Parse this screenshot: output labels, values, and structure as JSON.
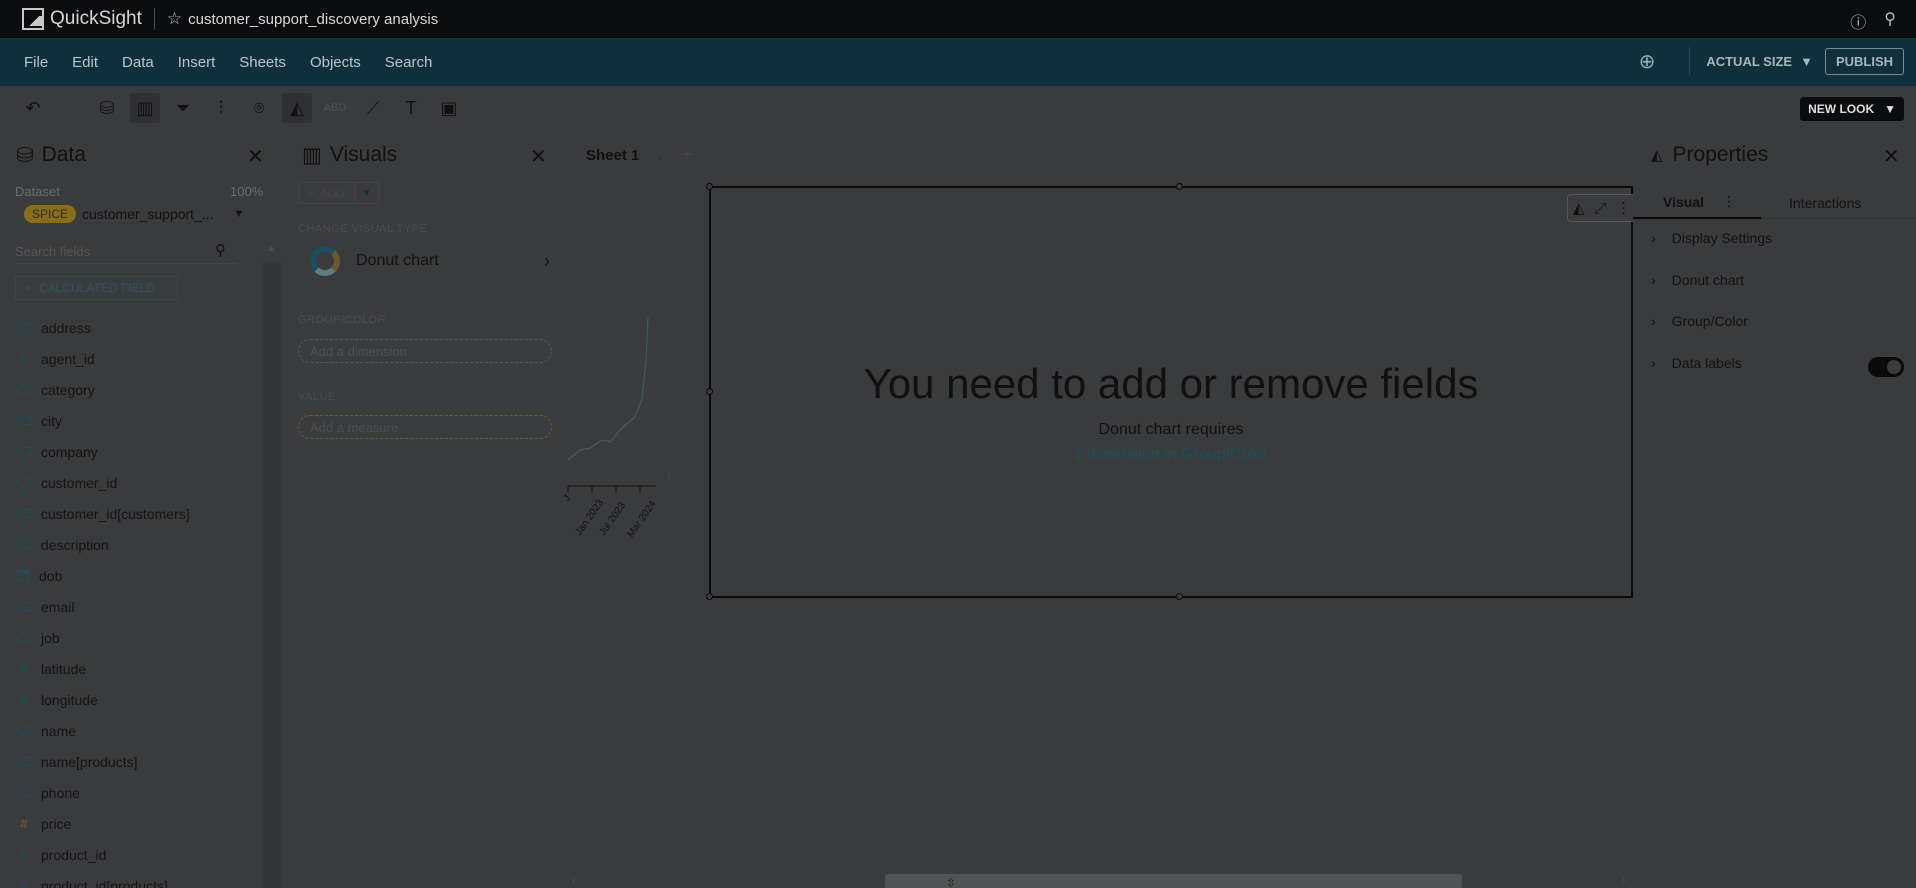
{
  "topbar": {
    "brand": "QuickSight",
    "analysis_title": "customer_support_discovery analysis"
  },
  "menu": {
    "items": [
      "File",
      "Edit",
      "Data",
      "Insert",
      "Sheets",
      "Objects",
      "Search"
    ],
    "actual_size": "ACTUAL SIZE",
    "publish": "PUBLISH"
  },
  "toolbar": {
    "new_look": "NEW LOOK",
    "dim_tool_label": "ABD"
  },
  "data_panel": {
    "title": "Data",
    "dataset_label": "Dataset",
    "dataset_pct": "100%",
    "spice": "SPICE",
    "dataset_name": "customer_support_...",
    "search_placeholder": "Search fields",
    "calc_field": "CALCULATED FIELD",
    "fields": [
      {
        "name": "address",
        "kind": "tag"
      },
      {
        "name": "agent_id",
        "kind": "measure"
      },
      {
        "name": "category",
        "kind": "tag"
      },
      {
        "name": "city",
        "kind": "tag"
      },
      {
        "name": "company",
        "kind": "tag"
      },
      {
        "name": "customer_id",
        "kind": "tag"
      },
      {
        "name": "customer_id[customers]",
        "kind": "tag"
      },
      {
        "name": "description",
        "kind": "tag"
      },
      {
        "name": "dob",
        "kind": "date"
      },
      {
        "name": "email",
        "kind": "tag"
      },
      {
        "name": "job",
        "kind": "tag"
      },
      {
        "name": "latitude",
        "kind": "measure"
      },
      {
        "name": "longitude",
        "kind": "measure"
      },
      {
        "name": "name",
        "kind": "tag"
      },
      {
        "name": "name[products]",
        "kind": "tag"
      },
      {
        "name": "phone",
        "kind": "tag"
      },
      {
        "name": "price",
        "kind": "price"
      },
      {
        "name": "product_id",
        "kind": "measure"
      },
      {
        "name": "product_id[products]",
        "kind": "measure"
      }
    ]
  },
  "visuals_panel": {
    "title": "Visuals",
    "add": "ADD",
    "change_visual_type": "CHANGE VISUAL TYPE",
    "visual_type": "Donut chart",
    "group_color_label": "GROUP/COLOR",
    "group_color_placeholder": "Add a dimension",
    "value_label": "VALUE",
    "value_placeholder": "Add a measure"
  },
  "sheet": {
    "tab_name": "Sheet 1"
  },
  "mini_chart": {
    "x_labels": [
      "Jan 2023",
      "Jul 2023",
      "Mar 2024"
    ],
    "first_tick": "J",
    "side_tick": "i"
  },
  "visual": {
    "message_title": "You need to add or remove fields",
    "message_sub": "Donut chart requires",
    "message_link": "1 dimension in Group/Color"
  },
  "properties": {
    "title": "Properties",
    "tab_visual": "Visual",
    "tab_interactions": "Interactions",
    "sections": [
      "Display Settings",
      "Donut chart",
      "Group/Color",
      "Data labels"
    ],
    "data_labels_on": true
  },
  "colors": {
    "topbar_bg": "#0b0c0e",
    "menubar_bg": "#0f2f3d",
    "overlay_bg": "#3a3b3d",
    "accent_teal": "#1c4f5c",
    "spice_gold": "#8a6d1a"
  }
}
